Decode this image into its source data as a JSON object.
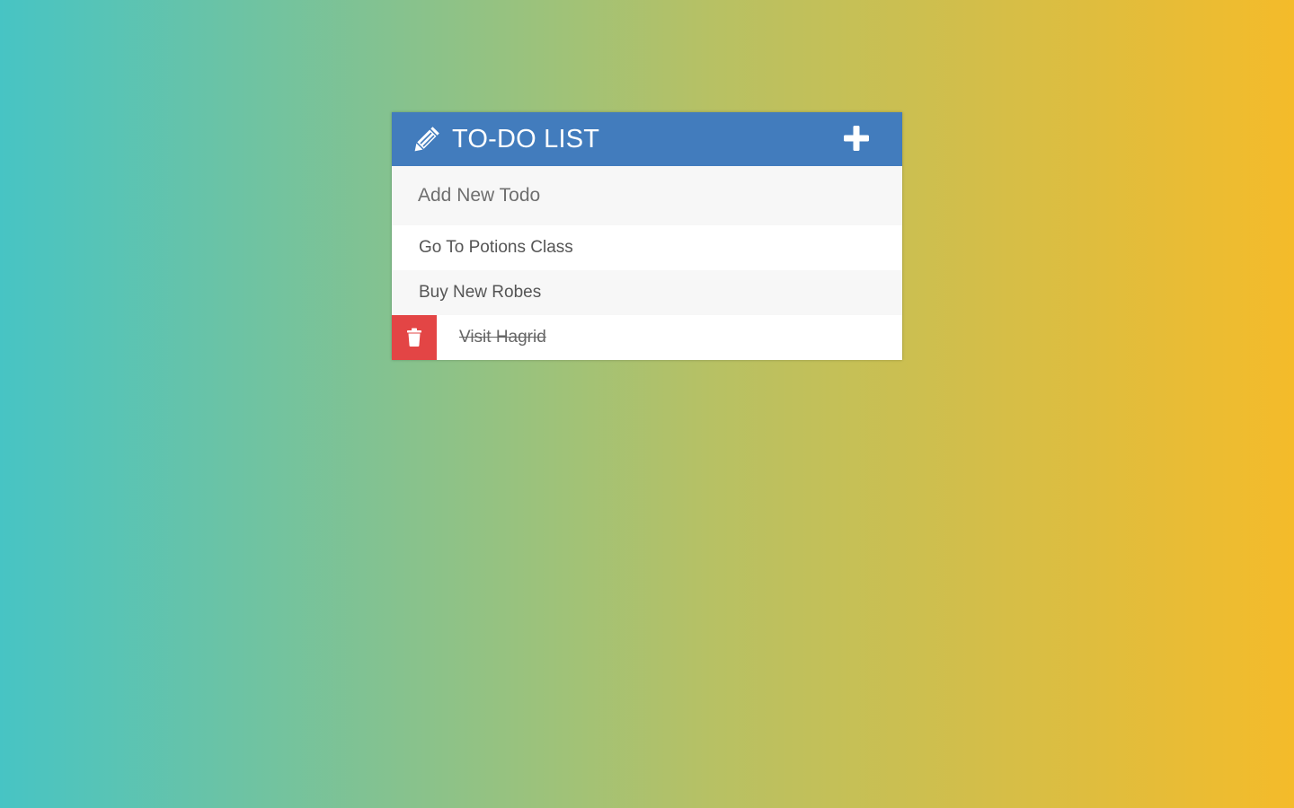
{
  "header": {
    "title": "TO-DO LIST",
    "icon": "pencil-icon",
    "add_icon": "plus-icon",
    "color": "#427cbd"
  },
  "new_todo": {
    "placeholder": "Add New Todo",
    "value": ""
  },
  "todos": [
    {
      "text": "Go To Potions Class",
      "completed": false
    },
    {
      "text": "Buy New Robes",
      "completed": false
    },
    {
      "text": "Visit Hagrid",
      "completed": true,
      "delete_icon": "trash-icon",
      "delete_color": "#e34545"
    }
  ],
  "background": {
    "gradient_start": "#47c4c4",
    "gradient_end": "#f4bb2a"
  }
}
